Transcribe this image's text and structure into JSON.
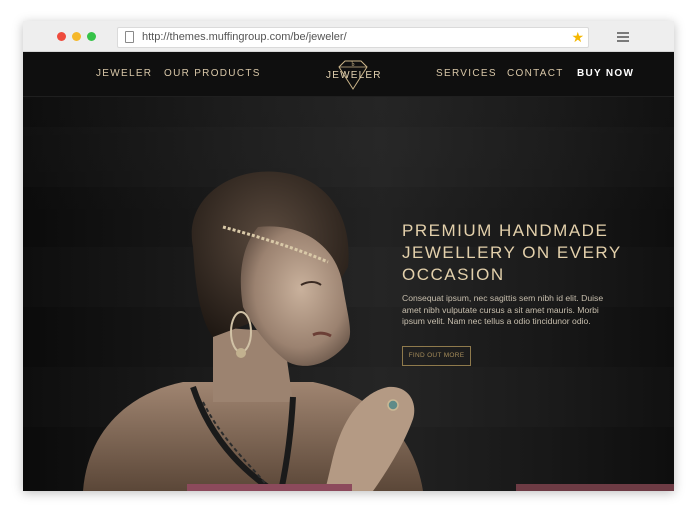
{
  "browser": {
    "url": "http://themes.muffingroup.com/be/jeweler/"
  },
  "nav": {
    "left": [
      "JEWELER",
      "OUR PRODUCTS"
    ],
    "right": [
      "SERVICES",
      "CONTACT",
      "BUY NOW"
    ],
    "logo_text": "JEWELER"
  },
  "hero": {
    "headline_lines": [
      "PREMIUM HANDMADE",
      "JEWELLERY ON EVERY",
      "OCCASION"
    ],
    "copy_lines": [
      "Consequat ipsum, nec sagittis sem nibh id elit. Duise",
      "amet nibh vulputate cursus a sit amet mauris. Morbi",
      "ipsum velit. Nam nec tellus a odio tincidunor odio."
    ],
    "cta": "FIND OUT MORE"
  },
  "colors": {
    "accent_gold": "#e3d0ab",
    "button_border": "#8f7a4c",
    "background": "#111111",
    "strip_pink": "#8c4a5c"
  },
  "icons": [
    "page-icon",
    "star-icon",
    "menu-icon",
    "diamond-logo-icon"
  ]
}
